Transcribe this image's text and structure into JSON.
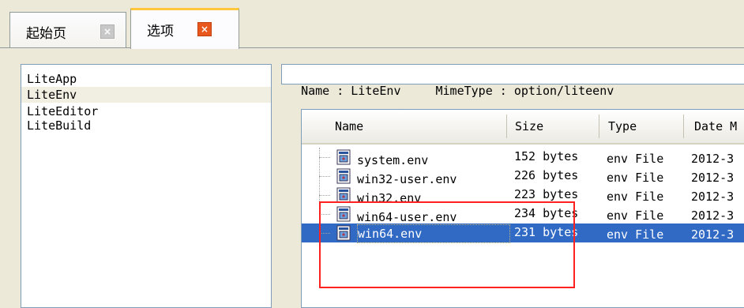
{
  "tabs": [
    {
      "label": "起始页",
      "active": false,
      "close_icon": "close-icon"
    },
    {
      "label": "选项",
      "active": true,
      "close_icon": "close-icon"
    }
  ],
  "options_list": [
    "LiteApp",
    "LiteEnv",
    "LiteEditor",
    "LiteBuild"
  ],
  "selected_option": "LiteEnv",
  "info": {
    "name_label": "Name : LiteEnv",
    "mime_label": "MimeType : option/liteenv"
  },
  "file_table": {
    "columns": [
      "Name",
      "Size",
      "Type",
      "Date M"
    ],
    "rows": [
      {
        "name": "system.env",
        "size": "152 bytes",
        "type": "env File",
        "date": "2012-3"
      },
      {
        "name": "win32-user.env",
        "size": "226 bytes",
        "type": "env File",
        "date": "2012-3"
      },
      {
        "name": "win32.env",
        "size": "223 bytes",
        "type": "env File",
        "date": "2012-3"
      },
      {
        "name": "win64-user.env",
        "size": "234 bytes",
        "type": "env File",
        "date": "2012-3"
      },
      {
        "name": "win64.env",
        "size": "231 bytes",
        "type": "env File",
        "date": "2012-3"
      }
    ],
    "selected_row": "win64.env"
  },
  "colors": {
    "selection": "#316ac5",
    "annotation": "#ff2020",
    "tab_accent": "#ffc83c"
  }
}
